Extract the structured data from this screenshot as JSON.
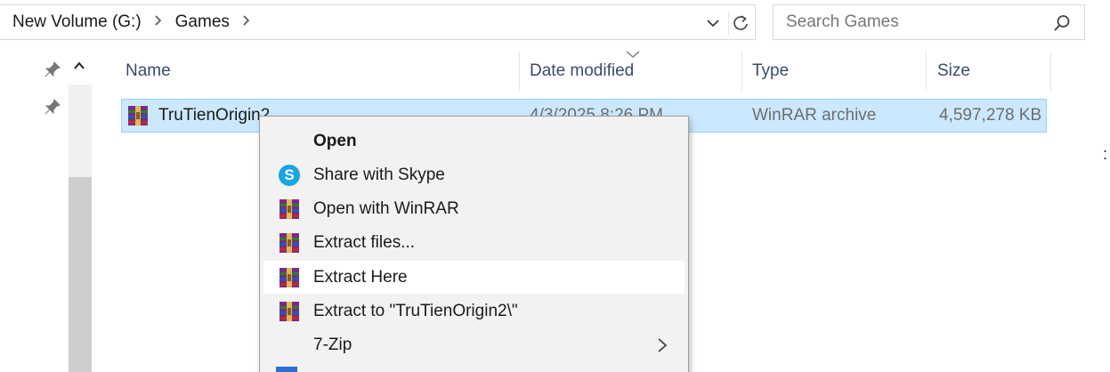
{
  "address": {
    "breadcrumb": [
      "New Volume (G:)",
      "Games"
    ]
  },
  "search": {
    "placeholder": "Search Games"
  },
  "columns": [
    {
      "label": "Name"
    },
    {
      "label": "Date modified"
    },
    {
      "label": "Type"
    },
    {
      "label": "Size"
    }
  ],
  "file": {
    "name": "TruTienOrigin2",
    "date_partial": "4/3/2025 8:26 PM",
    "type": "WinRAR archive",
    "size": "4,597,278 KB"
  },
  "context_menu": {
    "items": [
      {
        "label": "Open",
        "icon": "none",
        "bold": true
      },
      {
        "label": "Share with Skype",
        "icon": "skype-icon"
      },
      {
        "label": "Open with WinRAR",
        "icon": "winrar-icon"
      },
      {
        "label": "Extract files...",
        "icon": "winrar-icon"
      },
      {
        "label": "Extract Here",
        "icon": "winrar-icon",
        "highlighted": true
      },
      {
        "label": "Extract to \"TruTienOrigin2\\\"",
        "icon": "winrar-icon"
      },
      {
        "label": "7-Zip",
        "icon": "none",
        "submenu": true
      }
    ]
  },
  "colors": {
    "selection_bg": "#cce8ff",
    "selection_border": "#99d1ff",
    "menu_bg": "#f2f2f2",
    "header_text": "#3a4b6a",
    "skype_blue": "#1aa4e0"
  }
}
